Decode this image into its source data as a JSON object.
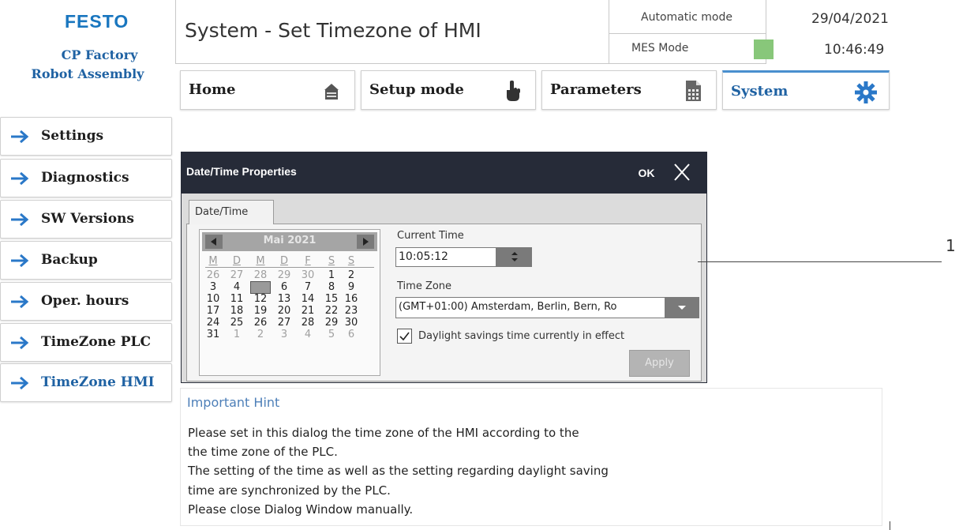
{
  "logo": {
    "brand": "FESTO",
    "line1": "CP Factory",
    "line2": "Robot Assembly"
  },
  "header": {
    "title": "System - Set Timezone of HMI",
    "auto_mode": "Automatic mode",
    "mes_mode": "MES Mode",
    "mes_indicator_color": "#88c77a",
    "date": "29/04/2021",
    "time": "10:46:49"
  },
  "tabs": [
    {
      "label": "Home",
      "icon": "home-icon"
    },
    {
      "label": "Setup mode",
      "icon": "hand-pointer-icon"
    },
    {
      "label": "Parameters",
      "icon": "document-calculator-icon"
    },
    {
      "label": "System",
      "icon": "gear-icon",
      "active": true
    }
  ],
  "sidebar": {
    "items": [
      {
        "label": "Settings"
      },
      {
        "label": "Diagnostics"
      },
      {
        "label": "SW Versions"
      },
      {
        "label": "Backup"
      },
      {
        "label": "Oper. hours"
      },
      {
        "label": "TimeZone PLC"
      },
      {
        "label": "TimeZone HMI",
        "active": true
      }
    ]
  },
  "dialog": {
    "title": "Date/Time Properties",
    "ok_label": "OK",
    "tab_label": "Date/Time",
    "calendar": {
      "month": "Mai 2021",
      "weekdays": [
        "M",
        "D",
        "M",
        "D",
        "F",
        "S",
        "S"
      ],
      "weeks": [
        [
          "26",
          "27",
          "28",
          "29",
          "30",
          "1",
          "2"
        ],
        [
          "3",
          "4",
          "5",
          "6",
          "7",
          "8",
          "9"
        ],
        [
          "10",
          "11",
          "12",
          "13",
          "14",
          "15",
          "16"
        ],
        [
          "17",
          "18",
          "19",
          "20",
          "21",
          "22",
          "23"
        ],
        [
          "24",
          "25",
          "26",
          "27",
          "28",
          "29",
          "30"
        ],
        [
          "31",
          "1",
          "2",
          "3",
          "4",
          "5",
          "6"
        ]
      ],
      "selected": "5"
    },
    "current_time_label": "Current Time",
    "current_time_value": "10:05:12",
    "timezone_label": "Time Zone",
    "timezone_value": "(GMT+01:00) Amsterdam, Berlin, Bern, Ro",
    "dst_label": "Daylight savings time currently in effect",
    "dst_checked": true,
    "apply_label": "Apply"
  },
  "callout": {
    "number": "1"
  },
  "hint": {
    "title": "Important Hint",
    "lines": [
      "Please set in this dialog the time zone of the HMI according to the",
      "the time zone of the PLC.",
      "The setting of the time as well as the setting regarding daylight saving",
      "time are synchronized by the PLC.",
      "Please close Dialog Window manually."
    ]
  }
}
